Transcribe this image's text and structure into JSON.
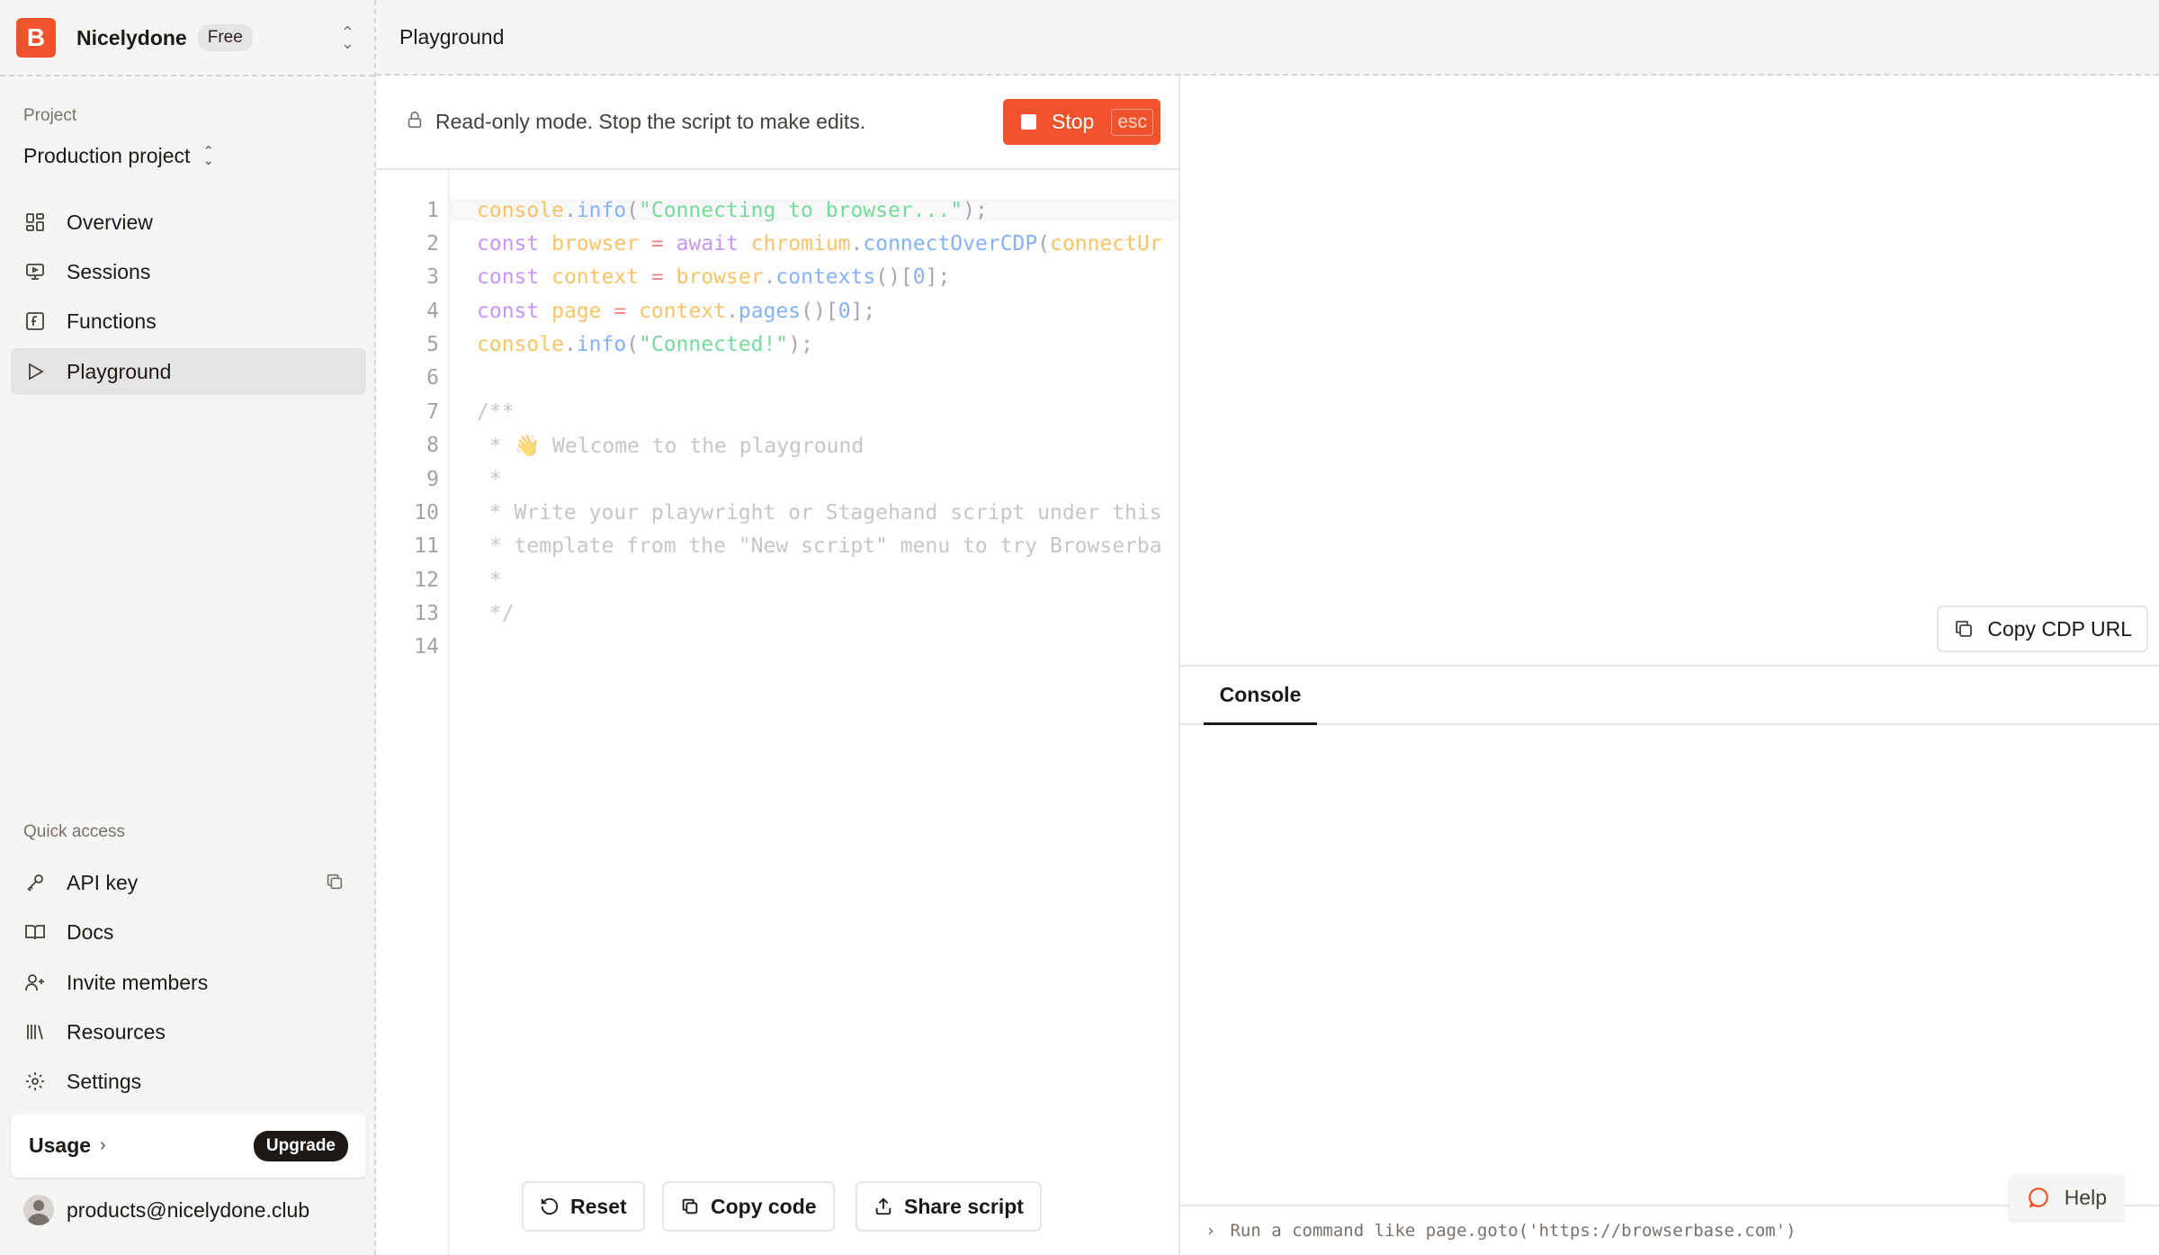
{
  "org": {
    "logo_letter": "B",
    "name": "Nicelydone",
    "plan": "Free"
  },
  "project": {
    "section_label": "Project",
    "name": "Production project"
  },
  "nav": [
    {
      "label": "Overview",
      "icon": "grid-icon"
    },
    {
      "label": "Sessions",
      "icon": "monitor-icon"
    },
    {
      "label": "Functions",
      "icon": "function-icon"
    },
    {
      "label": "Playground",
      "icon": "play-icon",
      "active": true
    }
  ],
  "quick_access": {
    "section_label": "Quick access",
    "items": [
      {
        "label": "API key",
        "icon": "key-icon"
      },
      {
        "label": "Docs",
        "icon": "book-icon"
      },
      {
        "label": "Invite members",
        "icon": "user-plus-icon"
      },
      {
        "label": "Resources",
        "icon": "library-icon"
      },
      {
        "label": "Settings",
        "icon": "gear-icon"
      }
    ]
  },
  "usage": {
    "label": "Usage",
    "upgrade_label": "Upgrade"
  },
  "user": {
    "email": "products@nicelydone.club"
  },
  "header": {
    "title": "Playground"
  },
  "editor": {
    "readonly_text": "Read-only mode. Stop the script to make edits.",
    "stop_label": "Stop",
    "stop_shortcut": "esc",
    "line_numbers": [
      "1",
      "2",
      "3",
      "4",
      "5",
      "6",
      "7",
      "8",
      "9",
      "10",
      "11",
      "12",
      "13",
      "14"
    ],
    "code_lines": [
      "console.info(\"Connecting to browser...\");",
      "const browser = await chromium.connectOverCDP(connectUr",
      "const context = browser.contexts()[0];",
      "const page = context.pages()[0];",
      "console.info(\"Connected!\");",
      "",
      "/**",
      " * 👋 Welcome to the playground",
      " *",
      " * Write your playwright or Stagehand script under this",
      " * template from the \"New script\" menu to try Browserba",
      " *",
      " */",
      ""
    ],
    "reset_label": "Reset",
    "copy_label": "Copy code",
    "share_label": "Share script"
  },
  "preview": {
    "copy_cdp_label": "Copy CDP URL"
  },
  "console": {
    "tab_label": "Console",
    "placeholder": "Run a command like page.goto('https://browserbase.com')"
  },
  "help": {
    "label": "Help"
  },
  "colors": {
    "accent": "#f0532c",
    "sidebar_bg": "#f5f5f4",
    "dark": "#1c1917"
  }
}
